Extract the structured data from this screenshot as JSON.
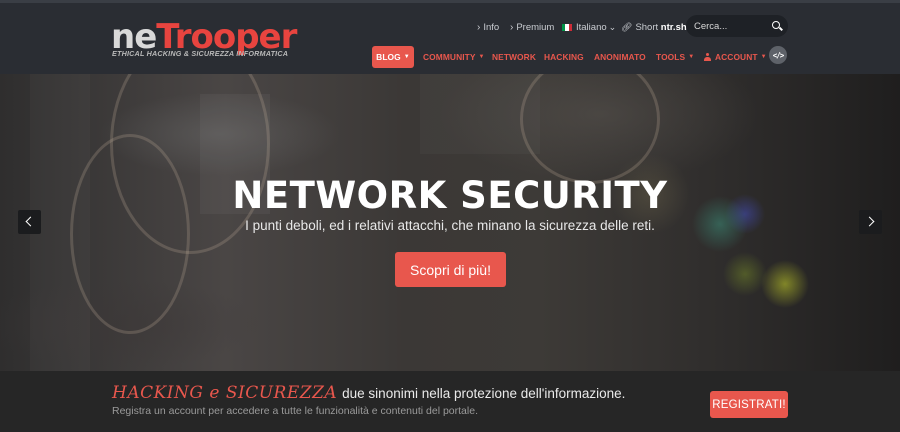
{
  "logo": {
    "main_ne": "ne",
    "main_trooper": "Trooper",
    "tagline": "ETHICAL HACKING & SICUREZZA INFORMATICA"
  },
  "utility": {
    "info": "Info",
    "premium": "Premium",
    "language": "Italiano",
    "language_caret": "⌄",
    "short_prefix": "Short",
    "short_domain": "ntr.sh",
    "flag_colors": [
      "#009246",
      "#ffffff",
      "#ce2b37"
    ]
  },
  "search": {
    "placeholder": "Cerca...",
    "icon": "search-icon"
  },
  "nav": {
    "blog": "BLOG",
    "community": "COMMUNITY",
    "network": "NETWORK",
    "hacking": "HACKING",
    "anonimato": "ANONIMATO",
    "tools": "TOOLS",
    "account": "ACCOUNT",
    "caret": "▼",
    "code_button": "</>"
  },
  "hero": {
    "title": "NETWORK SECURITY",
    "subtitle": "I punti deboli, ed i relativi attacchi, che minano la sicurezza delle reti.",
    "cta": "Scopri di più!"
  },
  "band": {
    "highlight": "HACKING e SICUREZZA",
    "text": "due sinonimi nella protezione dell'informazione.",
    "subtext": "Registra un account per accedere a tutte le funzionalità e contenuti del portale.",
    "register": "REGISTRATI!"
  },
  "colors": {
    "accent": "#e8574d",
    "header_bg": "#2a2d33",
    "band_bg": "#262626"
  }
}
